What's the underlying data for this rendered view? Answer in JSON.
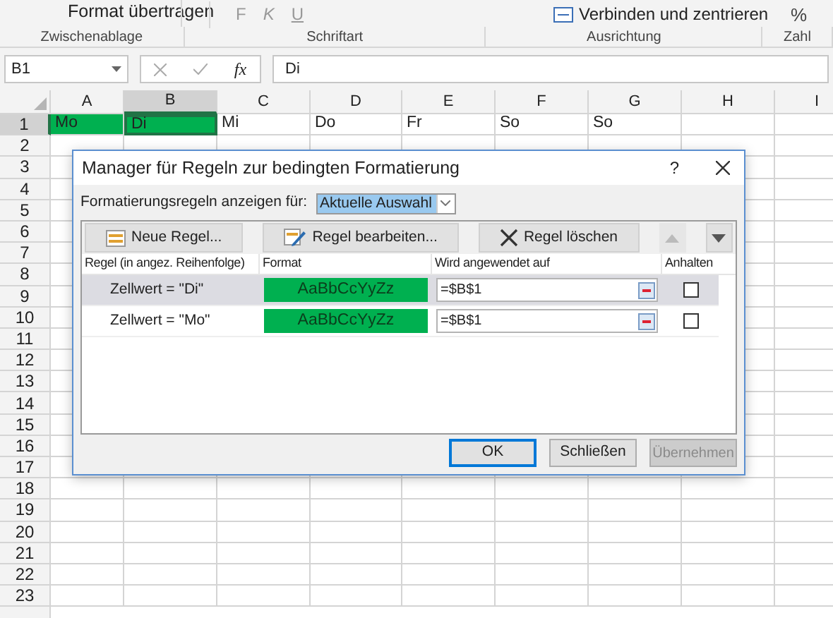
{
  "ribbon": {
    "clipboard_button": "Format übertragen",
    "font_buttons": [
      "F",
      "K",
      "U"
    ],
    "merge_button": "Verbinden und zentrieren",
    "number_button": "%",
    "groups": [
      "Zwischenablage",
      "Schriftart",
      "Ausrichtung",
      "Zahl"
    ]
  },
  "formula_bar": {
    "name_box": "B1",
    "fx": "fx",
    "value": "Di"
  },
  "sheet": {
    "columns": [
      {
        "label": "A",
        "selected": false
      },
      {
        "label": "B",
        "selected": true
      },
      {
        "label": "C",
        "selected": false
      },
      {
        "label": "D",
        "selected": false
      },
      {
        "label": "E",
        "selected": false
      },
      {
        "label": "F",
        "selected": false
      },
      {
        "label": "G",
        "selected": false
      },
      {
        "label": "H",
        "selected": false
      },
      {
        "label": "I",
        "selected": false
      }
    ],
    "rows": [
      {
        "label": "1",
        "selected": true
      },
      {
        "label": "2",
        "selected": false
      },
      {
        "label": "3",
        "selected": false
      },
      {
        "label": "4",
        "selected": false
      },
      {
        "label": "5",
        "selected": false
      },
      {
        "label": "6",
        "selected": false
      },
      {
        "label": "7",
        "selected": false
      },
      {
        "label": "8",
        "selected": false
      },
      {
        "label": "9",
        "selected": false
      },
      {
        "label": "10",
        "selected": false
      },
      {
        "label": "11",
        "selected": false
      },
      {
        "label": "12",
        "selected": false
      },
      {
        "label": "13",
        "selected": false
      },
      {
        "label": "14",
        "selected": false
      },
      {
        "label": "15",
        "selected": false
      },
      {
        "label": "16",
        "selected": false
      },
      {
        "label": "17",
        "selected": false
      },
      {
        "label": "18",
        "selected": false
      },
      {
        "label": "19",
        "selected": false
      },
      {
        "label": "20",
        "selected": false
      },
      {
        "label": "21",
        "selected": false
      },
      {
        "label": "22",
        "selected": false
      },
      {
        "label": "23",
        "selected": false
      }
    ],
    "row_1_cells": [
      {
        "text": "Mo",
        "highlighted": true,
        "selected": false
      },
      {
        "text": "Di",
        "highlighted": true,
        "selected": true
      },
      {
        "text": "Mi",
        "highlighted": false,
        "selected": false
      },
      {
        "text": "Do",
        "highlighted": false,
        "selected": false
      },
      {
        "text": "Fr",
        "highlighted": false,
        "selected": false
      },
      {
        "text": "So",
        "highlighted": false,
        "selected": false
      },
      {
        "text": "So",
        "highlighted": false,
        "selected": false
      }
    ]
  },
  "dialog": {
    "title": "Manager für Regeln zur bedingten Formatierung",
    "help": "?",
    "show_for_label": "Formatierungsregeln anzeigen für:",
    "show_for_value": "Aktuelle Auswahl",
    "toolbar": [
      {
        "kind": "new",
        "label": "Neue Regel...",
        "disabled": false
      },
      {
        "kind": "edit",
        "label": "Regel bearbeiten...",
        "disabled": false
      },
      {
        "kind": "delete",
        "label": "Regel löschen",
        "disabled": false
      },
      {
        "kind": "up",
        "disabled": true
      },
      {
        "kind": "down",
        "disabled": false
      }
    ],
    "columns": [
      "Regel (in angez. Reihenfolge)",
      "Format",
      "Wird angewendet auf",
      "Anhalten"
    ],
    "rules": [
      {
        "condition": "Zellwert = \"Di\"",
        "preview": "AaBbCcYyZz",
        "color": "#00b050",
        "applies_to": "=$B$1",
        "stop": false,
        "selected": true
      },
      {
        "condition": "Zellwert = \"Mo\"",
        "preview": "AaBbCcYyZz",
        "color": "#00b050",
        "applies_to": "=$B$1",
        "stop": false,
        "selected": false
      }
    ],
    "buttons": [
      {
        "label": "OK",
        "default": true,
        "disabled": false
      },
      {
        "label": "Schließen",
        "default": false,
        "disabled": false
      },
      {
        "label": "Übernehmen",
        "default": false,
        "disabled": true
      }
    ]
  }
}
